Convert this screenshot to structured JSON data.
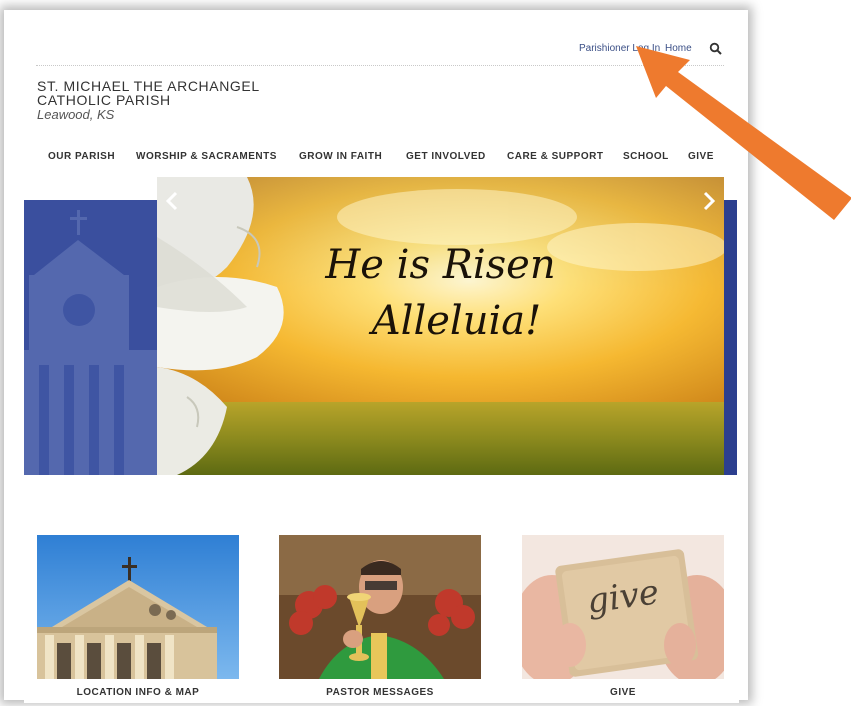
{
  "utility_nav": {
    "login_label": "Parishioner Log In",
    "home_label": "Home",
    "search_icon": "search-icon"
  },
  "brand": {
    "line1": "ST. MICHAEL THE ARCHANGEL",
    "line2": "CATHOLIC PARISH",
    "location": "Leawood, KS"
  },
  "main_nav": {
    "items": [
      {
        "label": "OUR PARISH"
      },
      {
        "label": "WORSHIP & SACRAMENTS"
      },
      {
        "label": "GROW IN FAITH"
      },
      {
        "label": "GET INVOLVED"
      },
      {
        "label": "CARE & SUPPORT"
      },
      {
        "label": "SCHOOL"
      },
      {
        "label": "GIVE"
      }
    ]
  },
  "hero": {
    "headline_line1": "He is Risen",
    "headline_line2": "Alleluia!"
  },
  "cards": [
    {
      "label": "LOCATION INFO & MAP"
    },
    {
      "label": "PASTOR MESSAGES"
    },
    {
      "label": "GIVE",
      "image_text": "give"
    }
  ],
  "colors": {
    "accent_blue": "#2c3f8f",
    "link_blue": "#3b4f86",
    "annotation_orange": "#ee7a2e"
  }
}
